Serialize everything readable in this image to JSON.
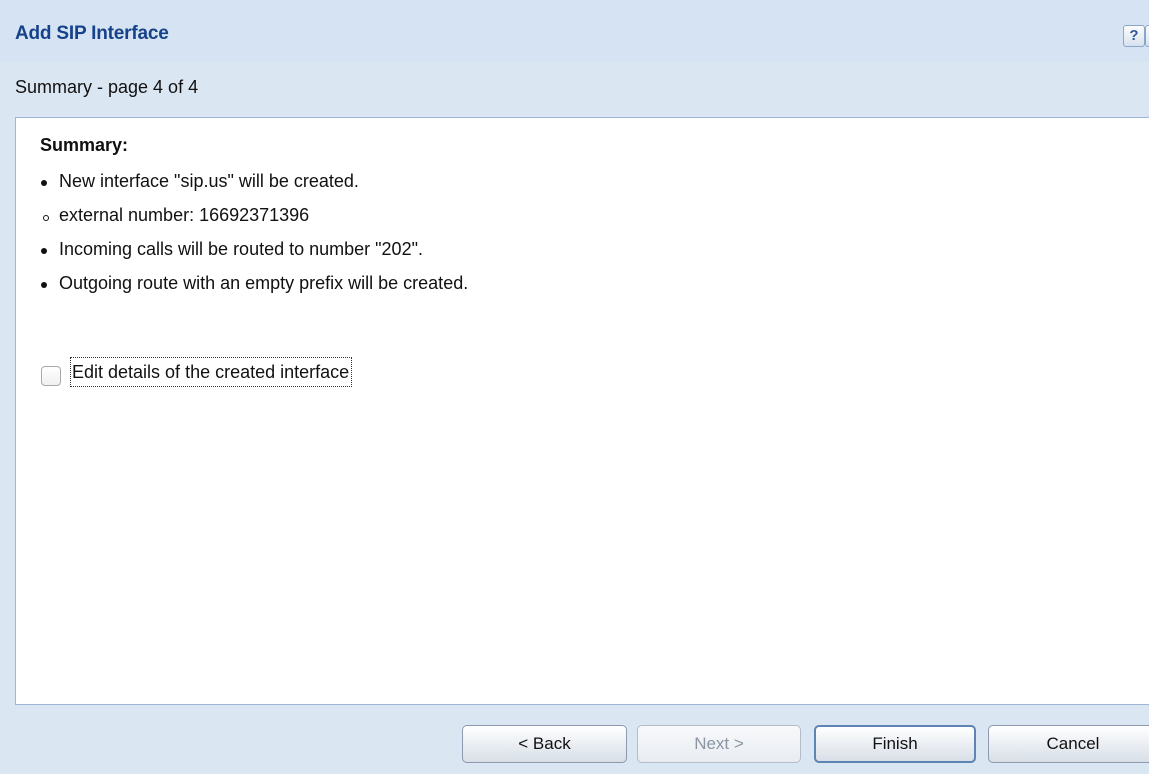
{
  "dialog": {
    "title": "Add SIP Interface",
    "subtitle": "Summary - page 4 of 4",
    "help_glyph": "?",
    "close_glyph": "✕"
  },
  "summary": {
    "heading": "Summary:",
    "items": [
      "New interface \"sip.us\" will be created.",
      "external number: 16692371396",
      "Incoming calls will be routed to number \"202\".",
      "Outgoing route with an empty prefix will be created."
    ]
  },
  "options": {
    "edit_details_label": "Edit details of the created interface",
    "edit_details_checked": false
  },
  "buttons": {
    "back": "< Back",
    "next": "Next >",
    "finish": "Finish",
    "cancel": "Cancel"
  },
  "colors": {
    "title": "#15428b",
    "frame_background": "#dbe6f3",
    "content_background": "#ffffff"
  },
  "icons": {
    "help": "help-icon",
    "close": "close-icon"
  }
}
